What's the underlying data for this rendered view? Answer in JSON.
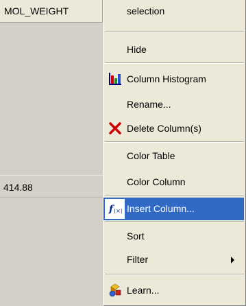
{
  "grid": {
    "header": "MOL_WEIGHT",
    "row_value": "414.88"
  },
  "menu": {
    "items": [
      {
        "label": "selection",
        "icon": null
      },
      {
        "label": "Hide",
        "icon": null
      },
      {
        "label": "Column Histogram",
        "icon": "histogram-icon"
      },
      {
        "label": "Rename...",
        "icon": null
      },
      {
        "label": "Delete Column(s)",
        "icon": "red-x-delete-icon"
      },
      {
        "label": "Color Table",
        "icon": null
      },
      {
        "label": "Color Column",
        "icon": null
      },
      {
        "label": "Insert Column...",
        "icon": "function-fx-icon",
        "highlighted": true
      },
      {
        "label": "Sort",
        "icon": null
      },
      {
        "label": "Filter",
        "icon": null,
        "submenu": true
      },
      {
        "label": "Learn...",
        "icon": "learn-shapes-icon"
      }
    ]
  },
  "colors": {
    "highlight": "#316ac5",
    "menu_bg": "#ece9d8",
    "grid_bg": "#d4d0c8"
  }
}
